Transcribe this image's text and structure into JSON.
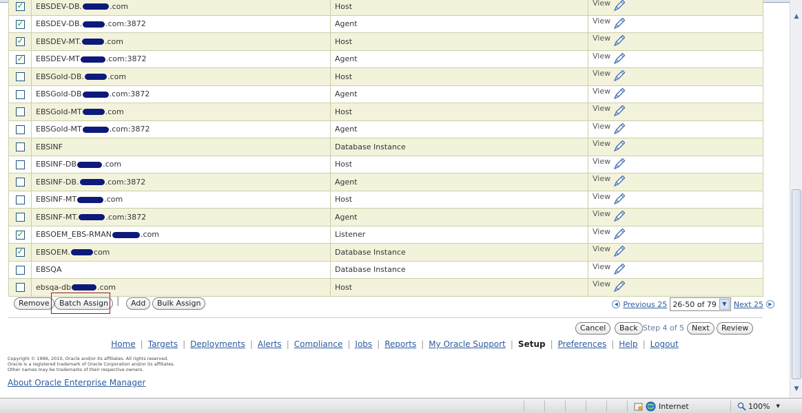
{
  "table": {
    "view_label": "View",
    "rows": [
      {
        "checked": true,
        "name_prefix": "EBSDEV-DB.",
        "redact_width": 38,
        "name_suffix": ".com",
        "type": "Host"
      },
      {
        "checked": true,
        "name_prefix": "EBSDEV-DB.",
        "redact_width": 32,
        "name_suffix": ".com:3872",
        "type": "Agent"
      },
      {
        "checked": true,
        "name_prefix": "EBSDEV-MT.",
        "redact_width": 32,
        "name_suffix": ".com",
        "type": "Host"
      },
      {
        "checked": true,
        "name_prefix": "EBSDEV-MT",
        "redact_width": 36,
        "name_suffix": ".com:3872",
        "type": "Agent"
      },
      {
        "checked": false,
        "name_prefix": "EBSGold-DB.",
        "redact_width": 32,
        "name_suffix": ".com",
        "type": "Host"
      },
      {
        "checked": false,
        "name_prefix": "EBSGold-DB",
        "redact_width": 38,
        "name_suffix": ".com:3872",
        "type": "Agent"
      },
      {
        "checked": false,
        "name_prefix": "EBSGold-MT",
        "redact_width": 32,
        "name_suffix": ".com",
        "type": "Host"
      },
      {
        "checked": false,
        "name_prefix": "EBSGold-MT",
        "redact_width": 38,
        "name_suffix": ".com:3872",
        "type": "Agent"
      },
      {
        "checked": false,
        "name_prefix": "EBSINF",
        "redact_width": 0,
        "name_suffix": "",
        "type": "Database Instance"
      },
      {
        "checked": false,
        "name_prefix": "EBSINF-DB",
        "redact_width": 36,
        "name_suffix": ".com",
        "type": "Host"
      },
      {
        "checked": false,
        "name_prefix": "EBSINF-DB.",
        "redact_width": 36,
        "name_suffix": ".com:3872",
        "type": "Agent"
      },
      {
        "checked": false,
        "name_prefix": "EBSINF-MT",
        "redact_width": 38,
        "name_suffix": ".com",
        "type": "Host"
      },
      {
        "checked": false,
        "name_prefix": "EBSINF-MT.",
        "redact_width": 38,
        "name_suffix": ".com:3872",
        "type": "Agent"
      },
      {
        "checked": true,
        "name_prefix": "EBSOEM_EBS-RMAN",
        "redact_width": 40,
        "name_suffix": ".com",
        "type": "Listener"
      },
      {
        "checked": true,
        "name_prefix": "EBSOEM.",
        "redact_width": 32,
        "name_suffix": "com",
        "type": "Database Instance"
      },
      {
        "checked": false,
        "name_prefix": "EBSQA",
        "redact_width": 0,
        "name_suffix": "",
        "type": "Database Instance"
      },
      {
        "checked": false,
        "name_prefix": "ebsqa-db",
        "redact_width": 36,
        "name_suffix": ".com",
        "type": "Host"
      }
    ]
  },
  "toolbar": {
    "remove": "Remove",
    "batch_assign": "Batch Assign",
    "separator": "|",
    "add": "Add",
    "bulk_assign": "Bulk Assign"
  },
  "pager": {
    "previous": "Previous 25",
    "range": "26-50 of 79",
    "next": "Next 25"
  },
  "train": {
    "cancel": "Cancel",
    "back": "Back",
    "step": "Step 4 of 5",
    "next": "Next",
    "review": "Review"
  },
  "global_nav": {
    "items": [
      "Home",
      "Targets",
      "Deployments",
      "Alerts",
      "Compliance",
      "Jobs",
      "Reports",
      "My Oracle Support",
      "Setup",
      "Preferences",
      "Help",
      "Logout"
    ],
    "active": "Setup"
  },
  "footer": {
    "copyright_1": "Copyright © 1996, 2010, Oracle and/or its affiliates. All rights reserved.",
    "copyright_2": "Oracle is a registered trademark of Oracle Corporation and/or its affiliates.",
    "copyright_3": "Other names may be trademarks of their respective owners.",
    "about_link": "About Oracle Enterprise Manager"
  },
  "statusbar": {
    "zone": "Internet",
    "zoom": "100%"
  },
  "colors": {
    "link": "#2c5b9e",
    "row_alt": "#f3f3dc",
    "check": "#21a121",
    "redaction": "#0d1a7a"
  }
}
